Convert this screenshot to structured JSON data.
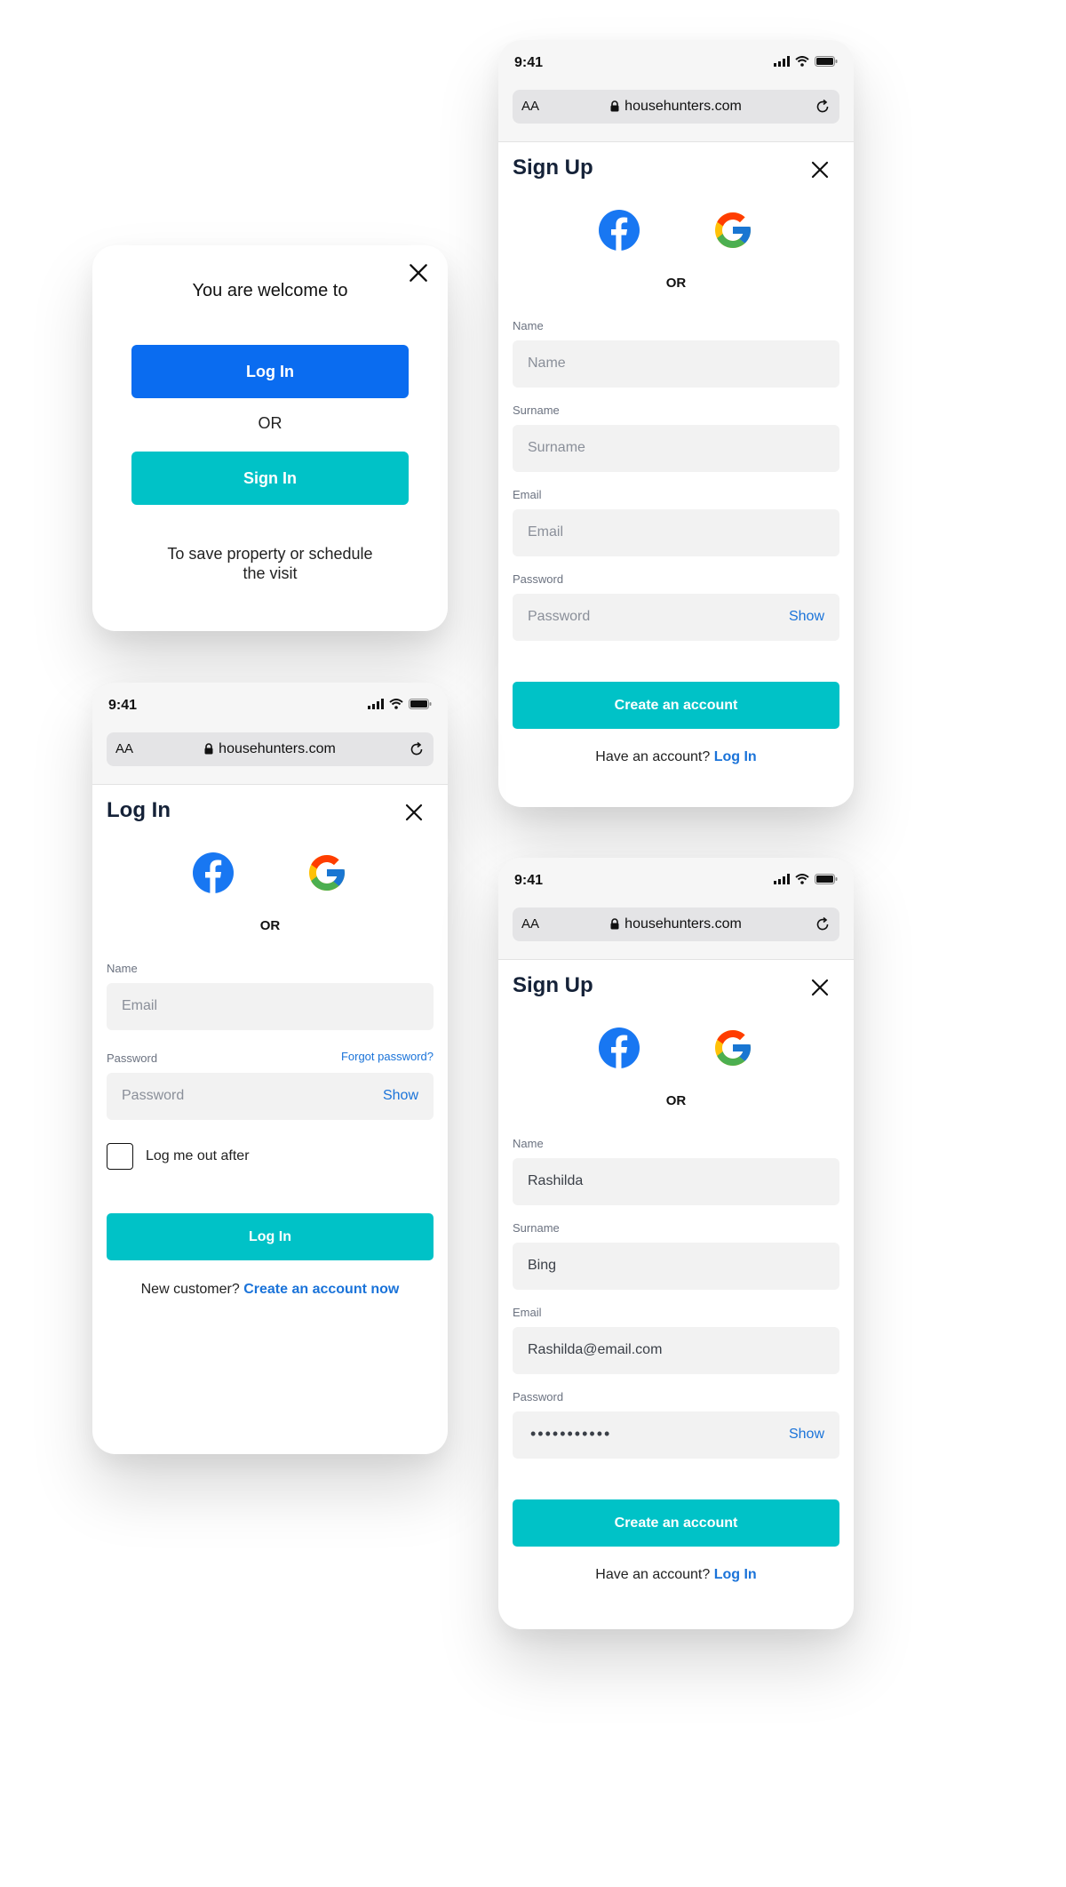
{
  "welcome": {
    "title": "You are welcome to",
    "login_button": "Log In",
    "or_text": "OR",
    "signin_button": "Sign In",
    "note": "To save property or schedule the visit"
  },
  "browser": {
    "time": "9:41",
    "text_size_label": "AA",
    "url": "househunters.com"
  },
  "login": {
    "title": "Log In",
    "or_text": "OR",
    "name_label": "Name",
    "email_placeholder": "Email",
    "password_label": "Password",
    "forgot_link": "Forgot password?",
    "password_placeholder": "Password",
    "show_label": "Show",
    "checkbox_label": "Log me out after",
    "submit_button": "Log In",
    "footer_text": "New customer?",
    "footer_link": "Create an account now"
  },
  "signup": {
    "title": "Sign Up",
    "or_text": "OR",
    "name_label": "Name",
    "name_placeholder": "Name",
    "surname_label": "Surname",
    "surname_placeholder": "Surname",
    "email_label": "Email",
    "email_placeholder": "Email",
    "password_label": "Password",
    "password_placeholder": "Password",
    "show_label": "Show",
    "submit_button": "Create an account",
    "footer_text": "Have an account?",
    "footer_link": "Log In"
  },
  "signup_filled": {
    "title": "Sign Up",
    "or_text": "OR",
    "name_label": "Name",
    "name_value": "Rashilda",
    "surname_label": "Surname",
    "surname_value": "Bing",
    "email_label": "Email",
    "email_value": "Rashilda@email.com",
    "password_label": "Password",
    "password_masked": "•••••••••••",
    "show_label": "Show",
    "submit_button": "Create an account",
    "footer_text": "Have an account?",
    "footer_link": "Log In"
  },
  "colors": {
    "primary_blue": "#0a6cf0",
    "teal": "#00c2c7",
    "link_blue": "#1a73d9",
    "facebook_blue": "#1877f2"
  }
}
